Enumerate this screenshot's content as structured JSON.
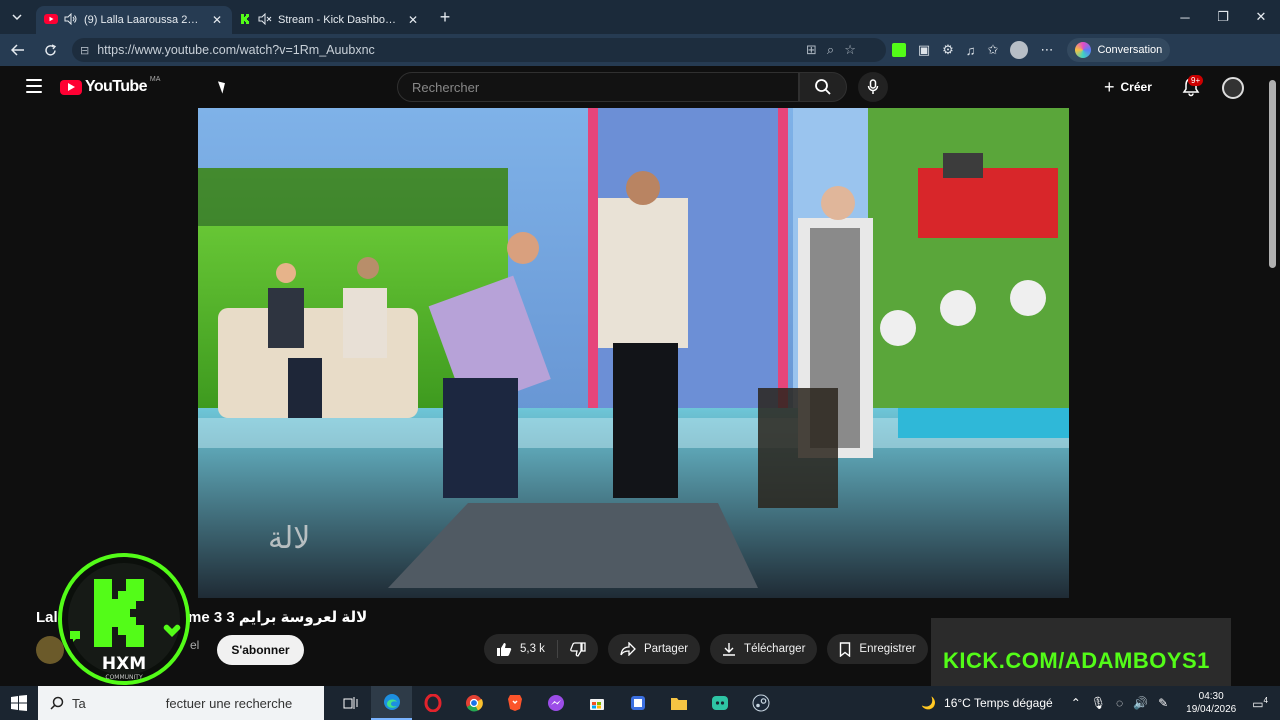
{
  "browser": {
    "tabs": [
      {
        "title": "(9) Lalla Laaroussa 2026 Prime",
        "favicon": "youtube-icon",
        "audio": "speaker-icon"
      },
      {
        "title": "Stream - Kick Dashboard",
        "favicon": "kick-icon",
        "audio": "speaker-muted-icon"
      }
    ],
    "url": "https://www.youtube.com/watch?v=1Rm_Auubxnc",
    "conversation_label": "Conversation"
  },
  "youtube": {
    "brand": "YouTube",
    "country": "MA",
    "search_placeholder": "Rechercher",
    "create_label": "Créer",
    "notif_badge": "9+",
    "video_title_visible_start": "Lal",
    "video_title_visible_end": "rime 3 لالة لعروسة برايم 3",
    "channel_visible": "el",
    "subscribe_label": "S'abonner",
    "like_count": "5,3 k",
    "share_label": "Partager",
    "download_label": "Télécharger",
    "save_label": "Enregistrer",
    "side_card_text": "KICK.COM/ADAMBOYS1"
  },
  "overlay": {
    "logo_text": "HXM",
    "logo_sub": "COMMUNITY"
  },
  "taskbar": {
    "search_text_visible": "fectuer une recherche",
    "search_prefix_visible": "Ta",
    "weather": "16°C  Temps dégagé",
    "time": "04:30",
    "date": "19/04/2026",
    "notif_count": "4"
  },
  "colors": {
    "kick_green": "#53fc18",
    "youtube_red": "#ff0033"
  }
}
